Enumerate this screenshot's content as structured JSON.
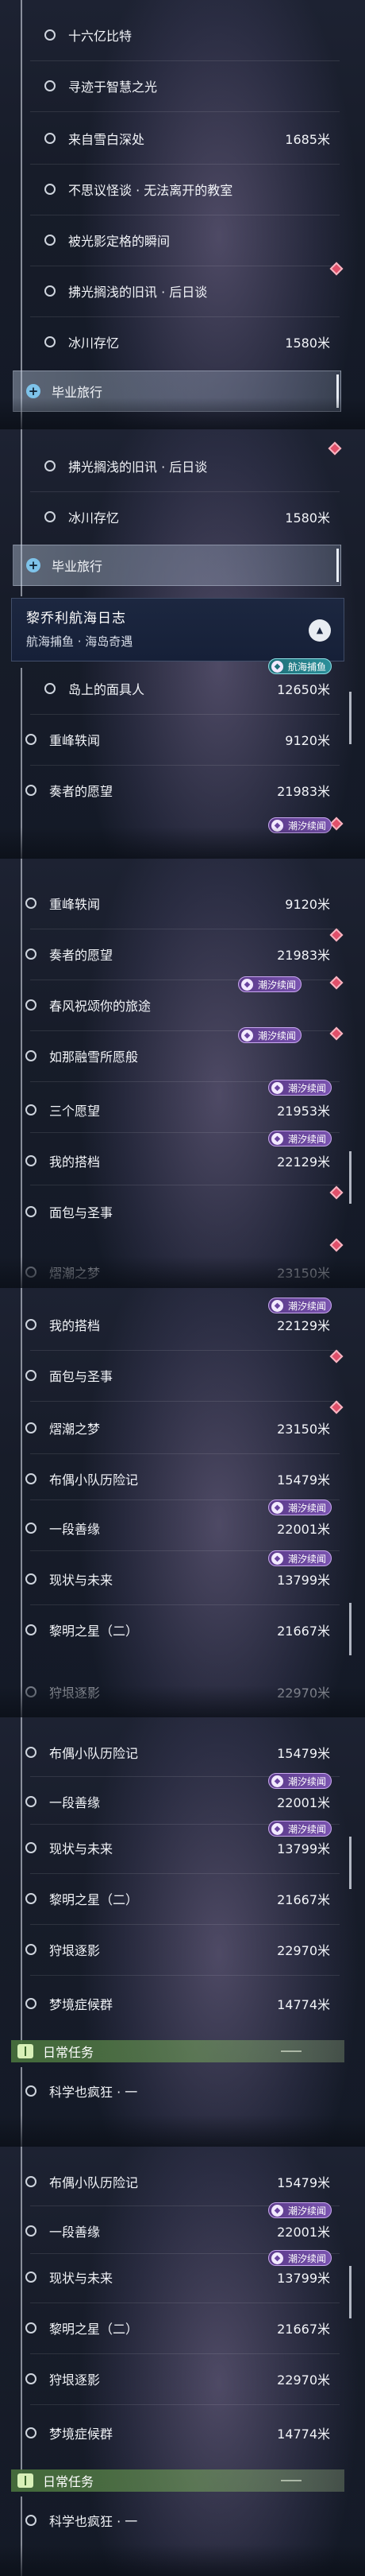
{
  "quests": {
    "p1": {
      "l1": "十六亿比特",
      "l2": "寻迹于智慧之光",
      "l3": "来自雪白深处",
      "d3": "1685米",
      "l4": "不思议怪谈 · 无法离开的教室",
      "l5": "被光影定格的瞬间",
      "l6": "拂光搁浅的旧讯 · 后日谈",
      "l7": "冰川存忆",
      "d7": "1580米",
      "l8": "毕业旅行"
    },
    "p2": {
      "l1": "拂光搁浅的旧讯 · 后日谈",
      "l2": "冰川存忆",
      "d2": "1580米",
      "l3": "毕业旅行",
      "header_title": "黎乔利航海日志",
      "header_sub": "航海捕鱼 · 海岛奇遇",
      "badge_fishing": "航海捕鱼",
      "l4": "岛上的面具人",
      "d4": "12650米",
      "l5": "重峰轶闻",
      "d5": "9120米",
      "l6": "奏者的愿望",
      "d6": "21983米",
      "badge_tide": "潮汐续闻"
    },
    "p3": {
      "l1": "重峰轶闻",
      "d1": "9120米",
      "l2": "奏者的愿望",
      "d2": "21983米",
      "l3": "春风祝颂你的旅途",
      "l4": "如那融雪所愿般",
      "l5": "三个愿望",
      "d5": "21953米",
      "l6": "我的搭档",
      "d6": "22129米",
      "l7": "面包与圣事",
      "l8": "熠潮之梦",
      "d8": "23150米",
      "b3": "潮汐续闻",
      "b4": "潮汐续闻",
      "b5": "潮汐续闻",
      "b6": "潮汐续闻"
    },
    "p4": {
      "l1": "我的搭档",
      "d1": "22129米",
      "l2": "面包与圣事",
      "l3": "熠潮之梦",
      "d3": "23150米",
      "l4": "布偶小队历险记",
      "d4": "15479米",
      "l5": "一段善缘",
      "d5": "22001米",
      "l6": "现状与未来",
      "d6": "13799米",
      "l7": "黎明之星（二）",
      "d7": "21667米",
      "l8": "狩垠逐影",
      "d8": "22970米",
      "b1": "潮汐续闻",
      "b5": "潮汐续闻",
      "b6": "潮汐续闻"
    },
    "p5": {
      "l1": "布偶小队历险记",
      "d1": "15479米",
      "l2": "一段善缘",
      "d2": "22001米",
      "l3": "现状与未来",
      "d3": "13799米",
      "l4": "黎明之星（二）",
      "d4": "21667米",
      "l5": "狩垠逐影",
      "d5": "22970米",
      "l6": "梦境症候群",
      "d6": "14774米",
      "cat": "日常任务",
      "l7": "科学也疯狂 · 一",
      "b2": "潮汐续闻",
      "b3": "潮汐续闻"
    },
    "p6": {
      "l1": "布偶小队历险记",
      "d1": "15479米",
      "l2": "一段善缘",
      "d2": "22001米",
      "l3": "现状与未来",
      "d3": "13799米",
      "l4": "黎明之星（二）",
      "d4": "21667米",
      "l5": "狩垠逐影",
      "d5": "22970米",
      "l6": "梦境症候群",
      "d6": "14774米",
      "cat": "日常任务",
      "l7": "科学也疯狂 · 一",
      "b2": "潮汐续闻",
      "b3": "潮汐续闻"
    }
  },
  "colors": {
    "accent_selected": "#7ec3ea",
    "badge_tide": "#7a54b0",
    "badge_fishing": "#2b8f9a",
    "tracked_marker": "#e0506a",
    "daily_category": "#78aa5a"
  },
  "icons": [
    "radio-ring-icon",
    "plus-icon",
    "diamond-marker-icon",
    "collapse-chevron-icon",
    "daily-task-icon",
    "tide-badge-icon",
    "fishing-badge-icon"
  ]
}
